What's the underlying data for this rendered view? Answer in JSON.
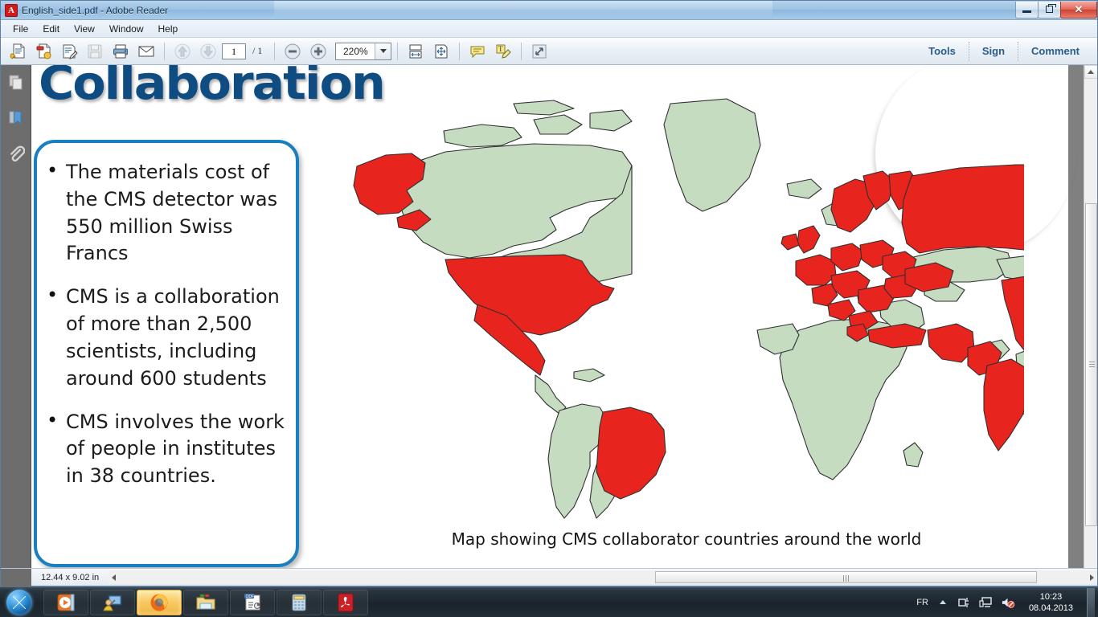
{
  "window": {
    "title": "English_side1.pdf - Adobe Reader",
    "app_icon": "adobe-reader-icon",
    "buttons": {
      "minimize": "minimize",
      "restore": "restore",
      "close": "close"
    }
  },
  "menu": {
    "items": [
      {
        "label": "File"
      },
      {
        "label": "Edit"
      },
      {
        "label": "View"
      },
      {
        "label": "Window"
      },
      {
        "label": "Help"
      }
    ]
  },
  "toolbar": {
    "left_tools": [
      {
        "name": "open-file-icon",
        "title": "Open"
      },
      {
        "name": "create-pdf-icon",
        "title": "Create PDF"
      },
      {
        "name": "edit-pdf-icon",
        "title": "Edit"
      },
      {
        "name": "save-icon",
        "title": "Save",
        "disabled": true
      },
      {
        "name": "print-icon",
        "title": "Print"
      },
      {
        "name": "email-icon",
        "title": "Email"
      }
    ],
    "page_prev": "previous-page",
    "page_next": "next-page",
    "page_current": "1",
    "page_total": "/ 1",
    "zoom_out": "zoom-out",
    "zoom_in": "zoom-in",
    "zoom_value": "220%",
    "fit_width": "fit-width",
    "fit_page": "fit-page",
    "comment_tool": "sticky-note",
    "highlight_tool": "text-highlight",
    "read_mode": "read-mode",
    "right_buttons": [
      {
        "label": "Tools"
      },
      {
        "label": "Sign"
      },
      {
        "label": "Comment"
      }
    ]
  },
  "nav_pane": {
    "items": [
      {
        "name": "page-thumbnails-icon"
      },
      {
        "name": "bookmarks-icon"
      },
      {
        "name": "attachments-icon"
      }
    ]
  },
  "document": {
    "title": "Collaboration",
    "callout": {
      "bullets": [
        "The materials cost of the CMS detector was 550 million Swiss Francs",
        "CMS is a collaboration of more than 2,500 scientists, including around 600 students",
        "CMS involves the work of people in institutes in 38 countries."
      ],
      "border_color": "#1a7fc1"
    },
    "map": {
      "caption": "Map showing CMS collaborator countries around the world",
      "highlight_color": "#e8241e",
      "base_color": "#c5dcc0",
      "outline_color": "#303030"
    }
  },
  "status_bar": {
    "page_size": "12.44 x 9.02 in",
    "hscroll_left": "scroll-left",
    "hscroll_right": "scroll-right"
  },
  "taskbar": {
    "start": "start-orb",
    "apps": [
      {
        "name": "windows-media-player-icon",
        "active": false
      },
      {
        "name": "remote-desktop-icon",
        "active": false
      },
      {
        "name": "firefox-icon",
        "active": true
      },
      {
        "name": "file-explorer-icon",
        "active": false
      },
      {
        "name": "odf-presentation-icon",
        "active": false
      },
      {
        "name": "calculator-icon",
        "active": false
      },
      {
        "name": "adobe-reader-icon",
        "active": false
      }
    ],
    "tray": {
      "language": "FR",
      "show_hidden": "show-hidden-icons",
      "network": "network-icon",
      "display": "display-icon",
      "volume": "volume-muted-icon",
      "time": "10:23",
      "date": "08.04.2013"
    }
  }
}
